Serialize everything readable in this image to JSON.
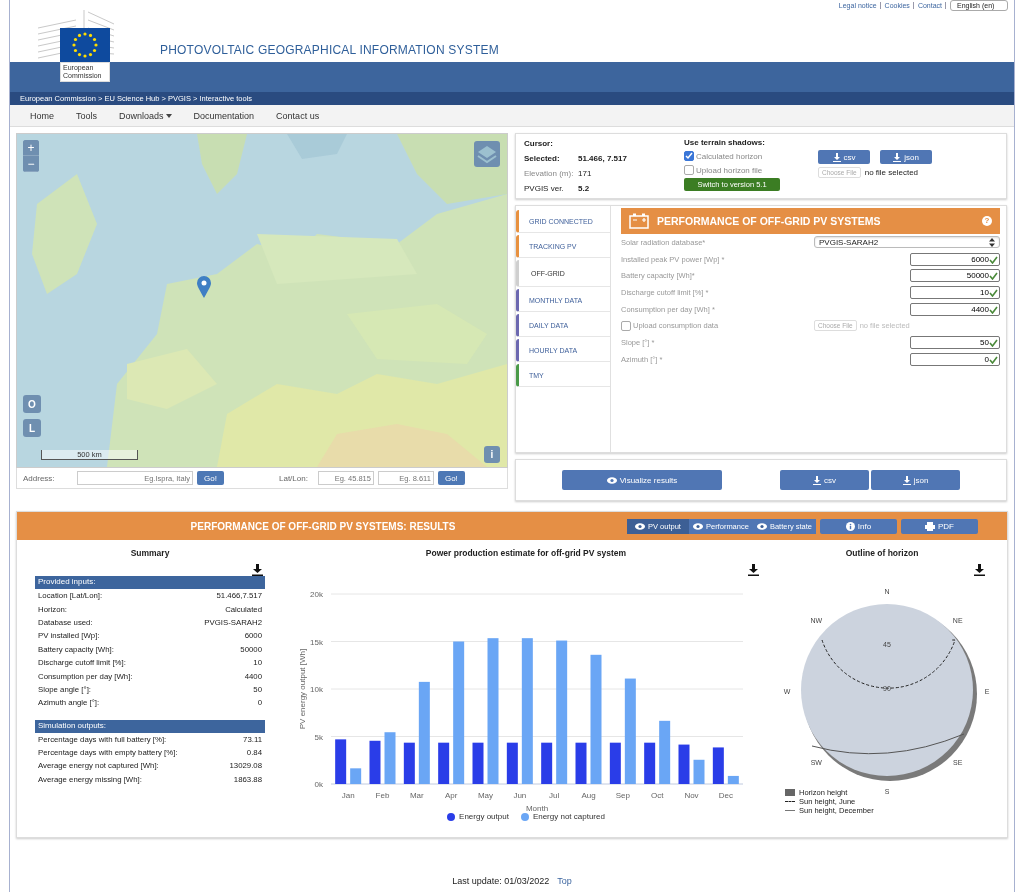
{
  "header": {
    "top_links": [
      "Legal notice",
      "Cookies",
      "Contact"
    ],
    "language": "English (en)",
    "logo_text": "European Commission",
    "title": "PHOTOVOLTAIC GEOGRAPHICAL INFORMATION SYSTEM"
  },
  "breadcrumb": "European Commission > EU Science Hub > PVGIS > Interactive tools",
  "nav": [
    {
      "label": "Home",
      "dropdown": false
    },
    {
      "label": "Tools",
      "dropdown": false
    },
    {
      "label": "Downloads",
      "dropdown": true
    },
    {
      "label": "Documentation",
      "dropdown": false
    },
    {
      "label": "Contact us",
      "dropdown": false
    }
  ],
  "map": {
    "zoom_in": "+",
    "zoom_out": "−",
    "buttons": [
      "O",
      "L"
    ],
    "info": "i",
    "scale": "500 km"
  },
  "address": {
    "label": "Address:",
    "placeholder": "Eg.Ispra, Italy",
    "go": "Go!",
    "latlon_label": "Lat/Lon:",
    "lat_placeholder": "Eg. 45.815",
    "lon_placeholder": "Eg. 8.611",
    "go2": "Go!"
  },
  "info": {
    "cursor_label": "Cursor:",
    "selected_label": "Selected:",
    "selected_value": "51.466, 7.517",
    "elevation_label": "Elevation (m):",
    "elevation": "171",
    "version_label": "PVGIS ver.",
    "version": "5.2",
    "terrain_title": "Use terrain shadows:",
    "terrain_options": [
      {
        "label": "Calculated horizon",
        "checked": true
      },
      {
        "label": "Upload horizon file",
        "checked": false
      }
    ],
    "switch_button": "Switch to version 5.1",
    "downloads": [
      "csv",
      "json"
    ],
    "choose_file": "Choose File",
    "no_file": "no file selected"
  },
  "tabs": [
    {
      "label": "GRID CONNECTED",
      "color": "#e8913f",
      "selected": false
    },
    {
      "label": "TRACKING PV",
      "color": "#e8913f",
      "selected": false
    },
    {
      "label": "OFF-GRID",
      "color": "#cfcfcf",
      "selected": true
    },
    {
      "label": "MONTHLY DATA",
      "color": "#6c68b0",
      "selected": false
    },
    {
      "label": "DAILY DATA",
      "color": "#6c68b0",
      "selected": false
    },
    {
      "label": "HOURLY DATA",
      "color": "#6c68b0",
      "selected": false
    },
    {
      "label": "TMY",
      "color": "#4a9a48",
      "selected": false
    }
  ],
  "form": {
    "title": "PERFORMANCE OF OFF-GRID PV SYSTEMS",
    "help": "?",
    "fields": [
      {
        "kind": "select",
        "label": "Solar radiation database*",
        "value": "PVGIS-SARAH2"
      },
      {
        "kind": "number",
        "label": "Installed peak PV power [Wp] *",
        "value": "6000"
      },
      {
        "kind": "number",
        "label": "Battery capacity [Wh]*",
        "value": "50000"
      },
      {
        "kind": "number",
        "label": "Discharge cutoff limit [%] *",
        "value": "10"
      },
      {
        "kind": "number",
        "label": "Consumption per day [Wh] *",
        "value": "4400"
      },
      {
        "kind": "upload",
        "label": "Upload consumption data",
        "checked": false,
        "button": "Choose File",
        "note": "no file selected"
      },
      {
        "kind": "number",
        "label": "Slope [°] *",
        "value": "50"
      },
      {
        "kind": "number",
        "label": "Azimuth [°] *",
        "value": "0"
      }
    ]
  },
  "actions": {
    "visualize": "Visualize results",
    "downloads": [
      "csv",
      "json"
    ]
  },
  "results": {
    "title": "PERFORMANCE OF OFF-GRID PV SYSTEMS: RESULTS",
    "views": [
      {
        "label": "PV output",
        "selected": true
      },
      {
        "label": "Performance",
        "selected": false
      },
      {
        "label": "Battery state",
        "selected": false
      }
    ],
    "info": "Info",
    "pdf": "PDF",
    "summary": {
      "title": "Summary",
      "sections": [
        {
          "heading": "Provided inputs:",
          "rows": [
            {
              "label": "Location [Lat/Lon]:",
              "value": "51.466,7.517"
            },
            {
              "label": "Horizon:",
              "value": "Calculated"
            },
            {
              "label": "Database used:",
              "value": "PVGIS-SARAH2"
            },
            {
              "label": "PV installed [Wp]:",
              "value": "6000"
            },
            {
              "label": "Battery capacity [Wh]:",
              "value": "50000"
            },
            {
              "label": "Discharge cutoff limit [%]:",
              "value": "10"
            },
            {
              "label": "Consumption per day [Wh]:",
              "value": "4400"
            },
            {
              "label": "Slope angle [°]:",
              "value": "50"
            },
            {
              "label": "Azimuth angle [°]:",
              "value": "0"
            }
          ]
        },
        {
          "heading": "Simulation outputs:",
          "rows": [
            {
              "label": "Percentage days with full battery [%]:",
              "value": "73.11"
            },
            {
              "label": "Percentage days with empty battery [%]:",
              "value": "0.84"
            },
            {
              "label": "Average energy not captured [Wh]:",
              "value": "13029.08"
            },
            {
              "label": "Average energy missing [Wh]:",
              "value": "1863.88"
            }
          ]
        }
      ]
    },
    "chart_data": {
      "type": "bar",
      "title": "Power production estimate for off-grid PV system",
      "xlabel": "Month",
      "ylabel": "PV energy output [Wh]",
      "categories": [
        "Jan",
        "Feb",
        "Mar",
        "Apr",
        "May",
        "Jun",
        "Jul",
        "Aug",
        "Sep",
        "Oct",
        "Nov",
        "Dec"
      ],
      "series": [
        {
          "name": "Energy output",
          "color": "#2a3de8",
          "values": [
            4700,
            4550,
            4350,
            4350,
            4350,
            4350,
            4350,
            4350,
            4350,
            4350,
            4150,
            3850
          ]
        },
        {
          "name": "Energy not captured",
          "color": "#6aa6f5",
          "values": [
            1650,
            5450,
            10750,
            15000,
            15350,
            15350,
            15100,
            13600,
            11100,
            6650,
            2550,
            850
          ]
        }
      ],
      "ylim": [
        0,
        20000
      ],
      "grid": true,
      "yticks": [
        {
          "value": 0,
          "label": "0k"
        },
        {
          "value": 5000,
          "label": "5k"
        },
        {
          "value": 10000,
          "label": "10k"
        },
        {
          "value": 15000,
          "label": "15k"
        },
        {
          "value": 20000,
          "label": "20k"
        }
      ]
    },
    "horizon": {
      "title": "Outline of horizon",
      "directions": [
        "N",
        "NE",
        "E",
        "SE",
        "S",
        "SW",
        "W",
        "NW"
      ],
      "rings": [
        "45",
        "90"
      ],
      "legend": [
        "Horizon height",
        "Sun height, June",
        "Sun height, December"
      ]
    }
  },
  "footer": {
    "text": "Last update: 01/03/2022",
    "link": "Top"
  }
}
